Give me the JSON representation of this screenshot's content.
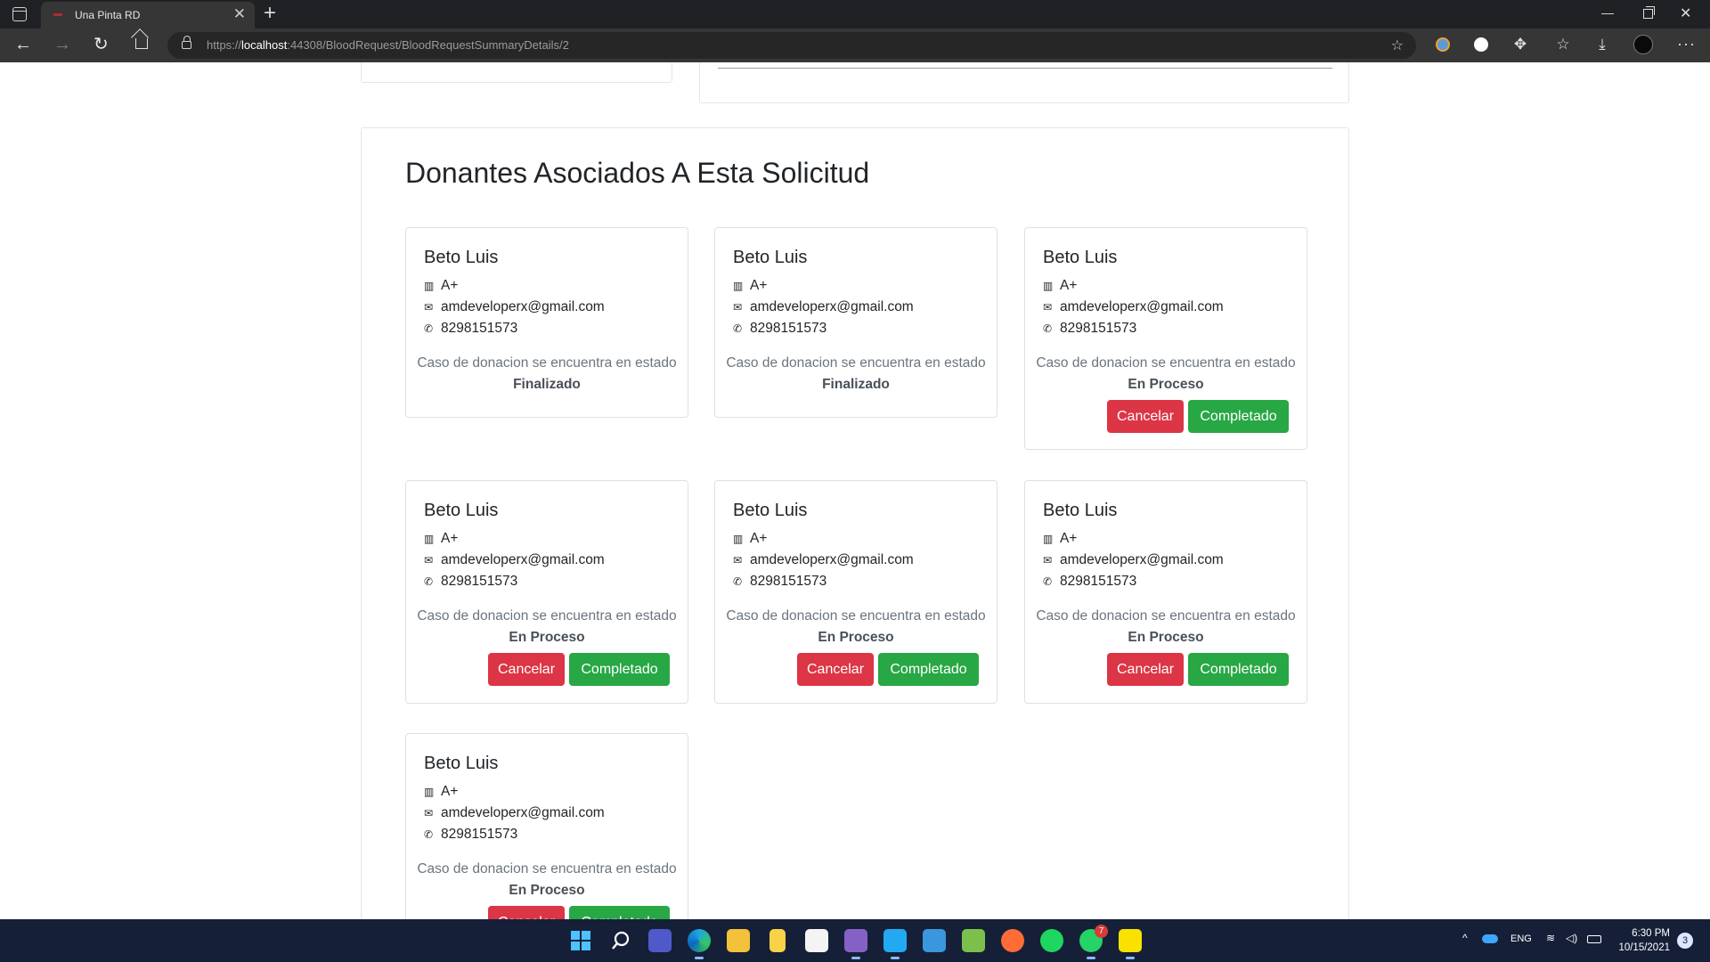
{
  "browser": {
    "tab_title": "Una Pinta RD",
    "url_prefix": "https://",
    "url_host": "localhost",
    "url_rest": ":44308/BloodRequest/BloodRequestSummaryDetails/2"
  },
  "page": {
    "section_title": "Donantes Asociados A Esta Solicitud",
    "donors": [
      {
        "name": "Beto Luis",
        "blood_type": "A+",
        "email": "amdeveloperx@gmail.com",
        "phone": "8298151573",
        "status_prefix": "Caso de donacion se encuentra en estado",
        "status": "Finalizado"
      },
      {
        "name": "Beto Luis",
        "blood_type": "A+",
        "email": "amdeveloperx@gmail.com",
        "phone": "8298151573",
        "status_prefix": "Caso de donacion se encuentra en estado",
        "status": "Finalizado"
      },
      {
        "name": "Beto Luis",
        "blood_type": "A+",
        "email": "amdeveloperx@gmail.com",
        "phone": "8298151573",
        "status_prefix": "Caso de donacion se encuentra en estado",
        "status": "En Proceso",
        "cancel_label": "Cancelar",
        "complete_label": "Completado"
      },
      {
        "name": "Beto Luis",
        "blood_type": "A+",
        "email": "amdeveloperx@gmail.com",
        "phone": "8298151573",
        "status_prefix": "Caso de donacion se encuentra en estado",
        "status": "En Proceso",
        "cancel_label": "Cancelar",
        "complete_label": "Completado"
      },
      {
        "name": "Beto Luis",
        "blood_type": "A+",
        "email": "amdeveloperx@gmail.com",
        "phone": "8298151573",
        "status_prefix": "Caso de donacion se encuentra en estado",
        "status": "En Proceso",
        "cancel_label": "Cancelar",
        "complete_label": "Completado"
      },
      {
        "name": "Beto Luis",
        "blood_type": "A+",
        "email": "amdeveloperx@gmail.com",
        "phone": "8298151573",
        "status_prefix": "Caso de donacion se encuentra en estado",
        "status": "En Proceso",
        "cancel_label": "Cancelar",
        "complete_label": "Completado"
      },
      {
        "name": "Beto Luis",
        "blood_type": "A+",
        "email": "amdeveloperx@gmail.com",
        "phone": "8298151573",
        "status_prefix": "Caso de donacion se encuentra en estado",
        "status": "En Proceso",
        "cancel_label": "Cancelar",
        "complete_label": "Completado"
      }
    ],
    "colors": {
      "danger": "#dc3545",
      "success": "#28a745",
      "muted": "#6c757d"
    }
  },
  "taskbar": {
    "language": "ENG",
    "time": "6:30 PM",
    "date": "10/15/2021",
    "whatsapp_badge": "7",
    "notification_count": "3",
    "apps": [
      "windows-start-icon",
      "search-icon",
      "teams-icon",
      "edge-icon",
      "file-explorer-icon",
      "sticky-note-icon",
      "store-icon",
      "visual-studio-icon",
      "vscode-icon",
      "azure-data-studio-icon",
      "app-icon",
      "postman-icon",
      "spotify-icon",
      "whatsapp-icon",
      "sticky-notes-icon"
    ]
  }
}
